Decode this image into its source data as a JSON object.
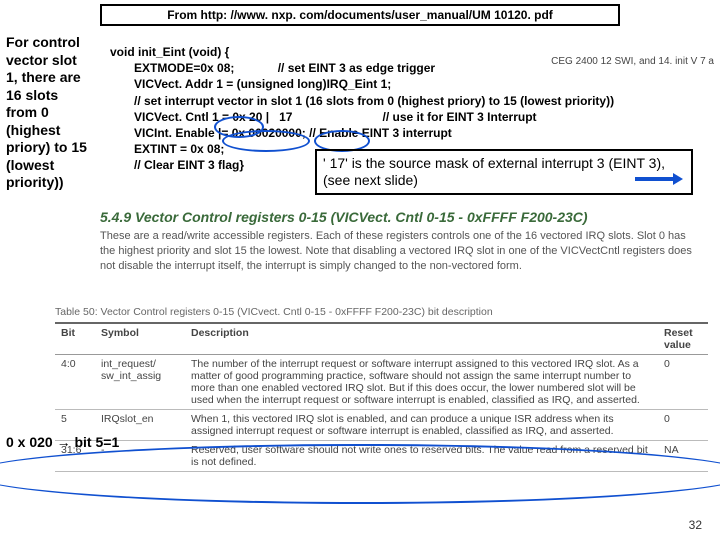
{
  "top_source": "From http: //www. nxp. com/documents/user_manual/UM 10120. pdf",
  "side_note": "For control vector slot 1, there are 16 slots from 0 (highest priory) to 15 (lowest priority))",
  "right_label": "CEG 2400 12 SWI, and 14. init V 7 a",
  "code": {
    "l1": "void init_Eint (void) {",
    "l2": "EXTMODE=0x 08;",
    "l2c": "// set EINT 3 as edge trigger",
    "l3": "VICVect. Addr 1 = (unsigned long)IRQ_Eint 1;",
    "l4": "// set interrupt vector in slot 1 (16 slots from 0 (highest priory) to 15 (lowest priority))",
    "l5": "VICVect. Cntl 1 = 0x 20 |",
    "l5b": "17",
    "l5c": "// use it for EINT 3 Interrupt",
    "l6": "VICInt. Enable |= 0x 00020000; // Enable EINT 3 interrupt",
    "l7": "EXTINT = 0x 08;",
    "l8": "// Clear EINT 3 flag}"
  },
  "note17": "' 17' is the source mask of external interrupt 3 (EINT 3), (see next slide)",
  "section": {
    "title": "5.4.9    Vector Control registers 0-15 (VICVect. Cntl 0-15 - 0xFFFF F200-23C)",
    "body": "These are a read/write accessible registers. Each of these registers controls one of the 16 vectored IRQ slots. Slot 0 has the highest priority and slot 15 the lowest. Note that disabling a vectored IRQ slot in one of the VICVectCntl registers does not disable the interrupt itself, the interrupt is simply changed to the non-vectored form."
  },
  "table": {
    "caption": "Table 50:   Vector Control registers 0-15 (VICvect. Cntl 0-15 - 0xFFFF F200-23C) bit description",
    "headers": [
      "Bit",
      "Symbol",
      "Description",
      "Reset value"
    ],
    "rows": [
      [
        "4:0",
        "int_request/\nsw_int_assig",
        "The number of the interrupt request or software interrupt assigned to this vectored IRQ slot. As a matter of good programming practice, software should not assign the same interrupt number to more than one enabled vectored IRQ slot. But if this does occur, the lower numbered slot will be used when the interrupt request or software interrupt is enabled, classified as IRQ, and asserted.",
        "0"
      ],
      [
        "5",
        "IRQslot_en",
        "When 1, this vectored IRQ slot is enabled, and can produce a unique ISR address when its assigned interrupt request or software interrupt is enabled, classified as IRQ, and asserted.",
        "0"
      ],
      [
        "31:6",
        "-",
        "Reserved, user software should not write ones to reserved bits. The value read from a reserved bit is not defined.",
        "NA"
      ]
    ]
  },
  "bit5_label": "0 x 020 → bit 5=1",
  "slide_number": "32"
}
